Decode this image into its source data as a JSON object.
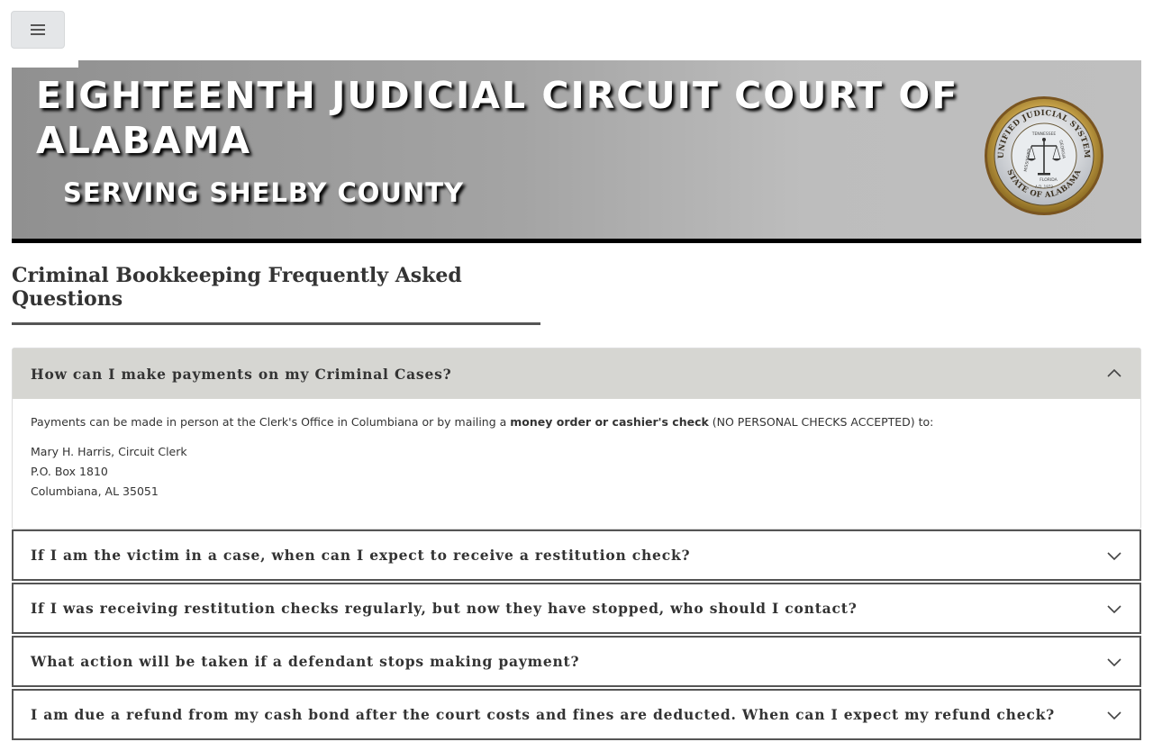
{
  "header": {
    "menu_icon": "hamburger-icon",
    "title": "EIGHTEENTH JUDICIAL CIRCUIT COURT OF ALABAMA",
    "subtitle": "SERVING SHELBY COUNTY",
    "seal": {
      "icon": "unified-judicial-system-seal",
      "text_top": "UNIFIED JUDICIAL SYSTEM",
      "text_bottom": "STATE OF ALABAMA",
      "text_left": "MISSISSIPPI",
      "text_tn": "TENNESSEE",
      "text_ga": "GEORGIA",
      "text_fl": "FLORIDA",
      "text_year": "A.D. 1973"
    }
  },
  "page": {
    "title": "Criminal Bookkeeping Frequently Asked Questions"
  },
  "faq": {
    "items": [
      {
        "question": "How can I make payments on my Criminal Cases?",
        "expanded": true,
        "answer_intro": "Payments can be made in person at the Clerk's Office in Columbiana or by mailing a ",
        "answer_bold": "money order or cashier's check",
        "answer_outro": " (NO PERSONAL CHECKS ACCEPTED) to:",
        "address": [
          "Mary H. Harris, Circuit Clerk",
          "P.O. Box 1810",
          "Columbiana, AL 35051"
        ]
      },
      {
        "question": "If I am the victim in a case, when can I expect to receive a restitution check?",
        "expanded": false
      },
      {
        "question": "If I was receiving restitution checks regularly, but now they have stopped, who should I contact?",
        "expanded": false
      },
      {
        "question": "What action will be taken if a defendant stops making payment?",
        "expanded": false
      },
      {
        "question": "I am due a refund from my cash bond after the court costs and fines are deducted. When can I expect my refund check?",
        "expanded": false
      }
    ]
  },
  "colors": {
    "banner_dark": "#909090",
    "banner_light": "#bfbfbf",
    "open_header_bg": "#d6d6d2",
    "border": "#555555"
  }
}
